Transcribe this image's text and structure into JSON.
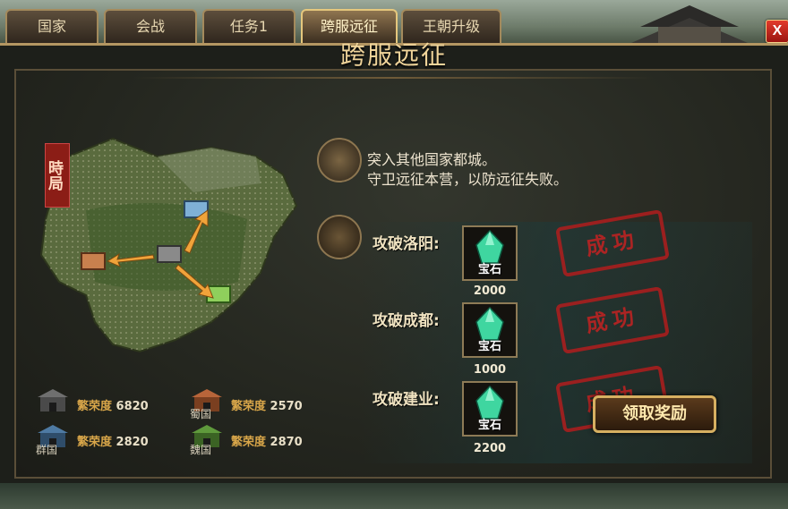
{
  "tabs": [
    {
      "label": "国家"
    },
    {
      "label": "会战"
    },
    {
      "label": "任务1"
    },
    {
      "label": "跨服远征",
      "active": true
    },
    {
      "label": "王朝升级"
    }
  ],
  "close_label": "X",
  "title": "跨服远征",
  "map_seal": "時局",
  "description": {
    "line1": "突入其他国家都城。",
    "line2": "守卫远征本营，以防远征失败。"
  },
  "objectives": [
    {
      "label": "攻破洛阳:",
      "reward_name": "宝石",
      "reward_amount": "2000",
      "status": "成功"
    },
    {
      "label": "攻破成都:",
      "reward_name": "宝石",
      "reward_amount": "1000",
      "status": "成功"
    },
    {
      "label": "攻破建业:",
      "reward_name": "宝石",
      "reward_amount": "2200",
      "status": "成功"
    }
  ],
  "claim_button": "领取奖励",
  "prosperity": [
    {
      "country": "",
      "label": "繁荣度",
      "value": "6820",
      "color": "#6f6f6f"
    },
    {
      "country": "蜀国",
      "label": "繁荣度",
      "value": "2570",
      "color": "#b8653a"
    },
    {
      "country": "群国",
      "label": "繁荣度",
      "value": "2820",
      "color": "#4e7aa3"
    },
    {
      "country": "魏国",
      "label": "繁荣度",
      "value": "2870",
      "color": "#5f9a3c"
    }
  ],
  "colors": {
    "accent_gold": "#e5c77d",
    "stamp_red": "#b01d1d",
    "gem_green": "#3fd6a0"
  }
}
